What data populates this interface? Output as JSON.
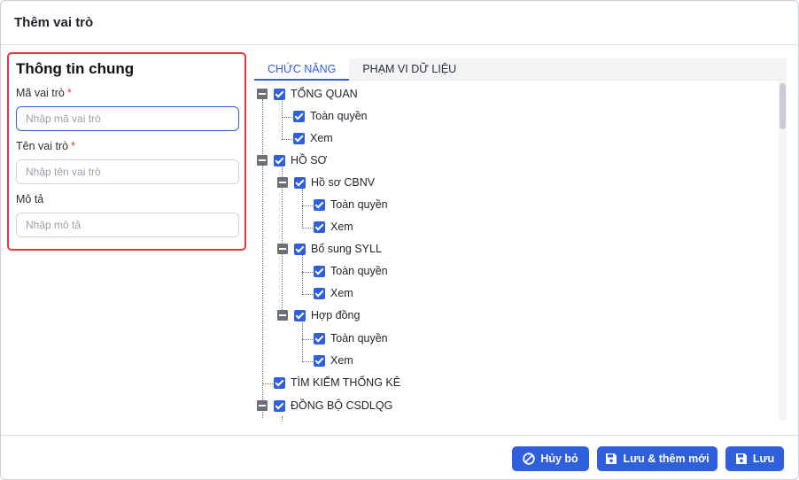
{
  "dialog": {
    "title": "Thêm vai trò"
  },
  "form": {
    "section_title": "Thông tin chung",
    "code": {
      "label": "Mã vai trò",
      "required_mark": "*",
      "placeholder": "Nhập mã vai trò",
      "value": ""
    },
    "name": {
      "label": "Tên vai trò",
      "required_mark": "*",
      "placeholder": "Nhập tên vai trò",
      "value": ""
    },
    "description": {
      "label": "Mô tả",
      "placeholder": "Nhập mô tả",
      "value": ""
    }
  },
  "tabs": [
    {
      "label": "CHỨC NĂNG",
      "active": true
    },
    {
      "label": "PHẠM VI DỮ LIỆU",
      "active": false
    }
  ],
  "tree": [
    {
      "label": "TỔNG QUAN",
      "checked": true,
      "expanded": true
    },
    {
      "label": "Toàn quyền",
      "checked": true
    },
    {
      "label": "Xem",
      "checked": true
    },
    {
      "label": "HỒ SƠ",
      "checked": true,
      "expanded": true
    },
    {
      "label": "Hồ sơ CBNV",
      "checked": true,
      "expanded": true
    },
    {
      "label": "Toàn quyền",
      "checked": true
    },
    {
      "label": "Xem",
      "checked": true
    },
    {
      "label": "Bổ sung SYLL",
      "checked": true,
      "expanded": true
    },
    {
      "label": "Toàn quyền",
      "checked": true
    },
    {
      "label": "Xem",
      "checked": true
    },
    {
      "label": "Hợp đồng",
      "checked": true,
      "expanded": true
    },
    {
      "label": "Toàn quyền",
      "checked": true
    },
    {
      "label": "Xem",
      "checked": true
    },
    {
      "label": "TÌM KIẾM THỐNG KÊ",
      "checked": true
    },
    {
      "label": "ĐỒNG BỘ CSDLQG",
      "checked": true,
      "expanded": true
    }
  ],
  "footer": {
    "cancel_label": "Hủy bỏ",
    "save_new_label": "Lưu & thêm mới",
    "save_label": "Lưu"
  },
  "icons": {
    "cancel": "ban-icon",
    "save": "floppy-disk-icon",
    "toggle": "minus-square-icon",
    "checkbox": "checkbox-checked-icon"
  },
  "colors": {
    "accent": "#2f5fdc",
    "highlight_border": "#e5373f",
    "required": "#e5373f"
  }
}
